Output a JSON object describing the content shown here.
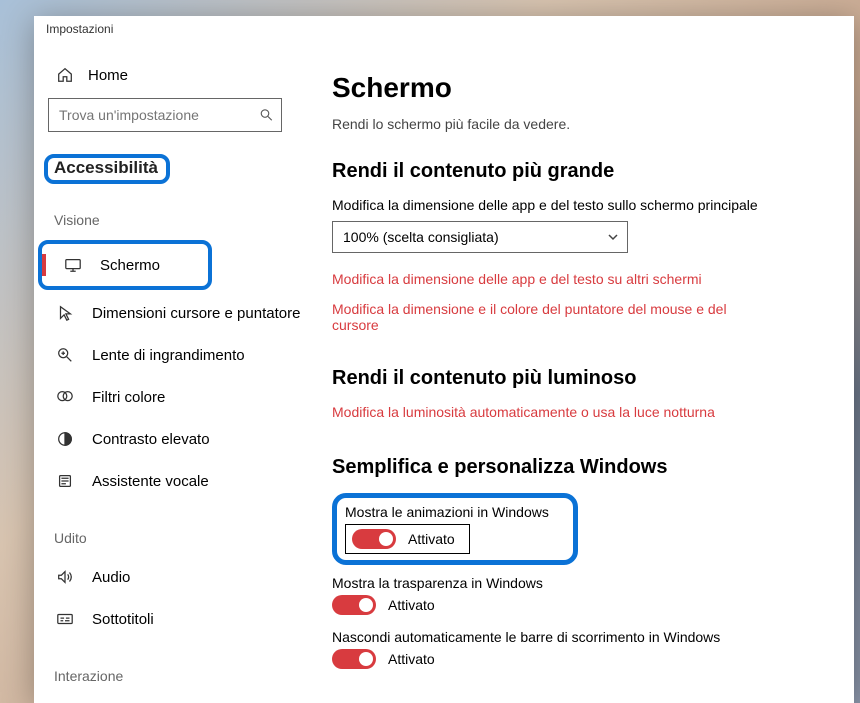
{
  "windowTitle": "Impostazioni",
  "homeLabel": "Home",
  "searchPlaceholder": "Trova un'impostazione",
  "sectionTitle": "Accessibilità",
  "categories": {
    "vision": "Visione",
    "hearing": "Udito",
    "interaction": "Interazione"
  },
  "nav": {
    "display": "Schermo",
    "cursor": "Dimensioni cursore e puntatore",
    "magnifier": "Lente di ingrandimento",
    "colorFilters": "Filtri colore",
    "highContrast": "Contrasto elevato",
    "narrator": "Assistente vocale",
    "audio": "Audio",
    "subtitles": "Sottotitoli"
  },
  "page": {
    "title": "Schermo",
    "subtitle": "Rendi lo schermo più facile da vedere."
  },
  "bigger": {
    "heading": "Rendi il contenuto più grande",
    "label": "Modifica la dimensione delle app e del testo sullo schermo principale",
    "dropdownValue": "100% (scelta consigliata)",
    "link1": "Modifica la dimensione delle app e del testo su altri schermi",
    "link2": "Modifica la dimensione e il colore del puntatore del mouse e del cursore"
  },
  "brighter": {
    "heading": "Rendi il contenuto più luminoso",
    "link1": "Modifica la luminosità automaticamente o usa la luce notturna"
  },
  "simplify": {
    "heading": "Semplifica e personalizza Windows",
    "animLabel": "Mostra le animazioni in Windows",
    "animState": "Attivato",
    "transLabel": "Mostra la trasparenza in Windows",
    "transState": "Attivato",
    "scrollLabel": "Nascondi automaticamente le barre di scorrimento in Windows",
    "scrollState": "Attivato"
  }
}
